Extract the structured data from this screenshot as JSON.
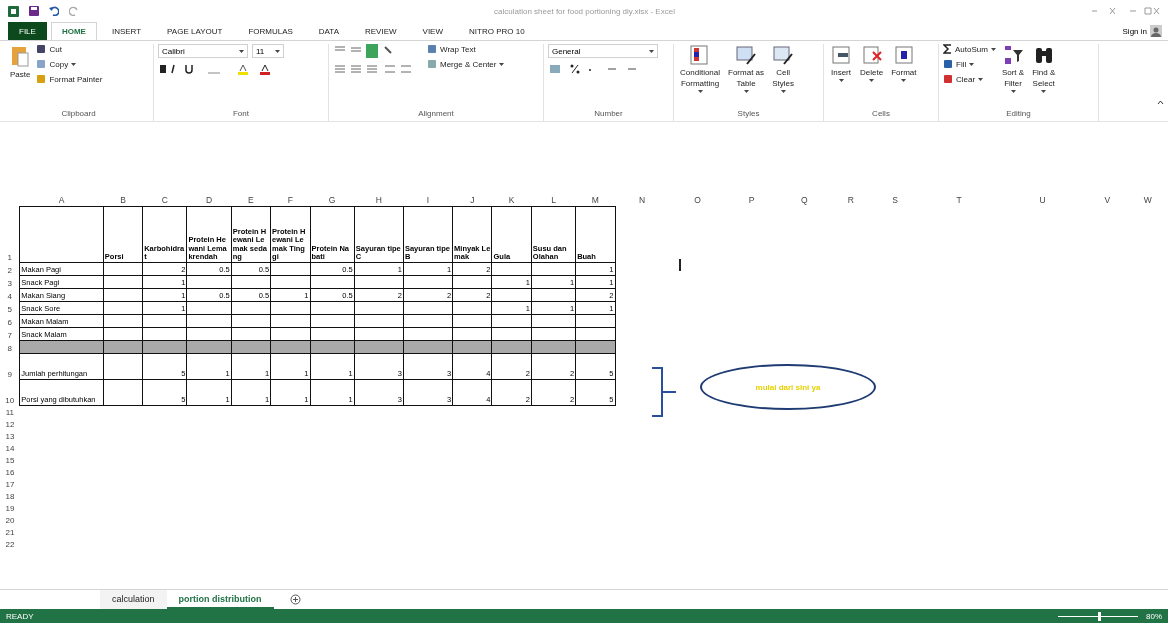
{
  "title_bar": {
    "title": "calculation sheet for food portioning diy.xlsx - Excel"
  },
  "ribbon_tabs": [
    {
      "label": "FILE",
      "kind": "file",
      "selected": false
    },
    {
      "label": "HOME",
      "kind": "tab",
      "selected": true
    },
    {
      "label": "INSERT",
      "kind": "tab",
      "selected": false
    },
    {
      "label": "PAGE LAYOUT",
      "kind": "tab",
      "selected": false
    },
    {
      "label": "FORMULAS",
      "kind": "tab",
      "selected": false
    },
    {
      "label": "DATA",
      "kind": "tab",
      "selected": false
    },
    {
      "label": "REVIEW",
      "kind": "tab",
      "selected": false
    },
    {
      "label": "VIEW",
      "kind": "tab",
      "selected": false
    },
    {
      "label": "NITRO PRO 10",
      "kind": "tab",
      "selected": false
    }
  ],
  "account": {
    "label": "Sign in"
  },
  "clipboard": {
    "paste": "Paste",
    "cut": "Cut",
    "copy": "Copy",
    "format_painter": "Format Painter",
    "group": "Clipboard"
  },
  "font": {
    "name": "Calibri",
    "size": "11",
    "group": "Font"
  },
  "alignment": {
    "wrap": "Wrap Text",
    "merge": "Merge & Center",
    "group": "Alignment"
  },
  "number": {
    "format": "General",
    "group": "Number"
  },
  "styles": {
    "group": "Styles",
    "buttons": [
      {
        "lines": [
          "Conditional",
          "Formatting"
        ],
        "kind": "conditional"
      },
      {
        "lines": [
          "Format as",
          "Table"
        ],
        "kind": "table"
      },
      {
        "lines": [
          "Cell",
          "Styles"
        ],
        "kind": "styles"
      }
    ]
  },
  "cells": {
    "group": "Cells",
    "buttons": [
      {
        "lines": [
          "Insert"
        ],
        "kind": "insert"
      },
      {
        "lines": [
          "Delete"
        ],
        "kind": "delete"
      },
      {
        "lines": [
          "Format"
        ],
        "kind": "format"
      }
    ]
  },
  "editing": {
    "group": "Editing",
    "autosum": "AutoSum",
    "fill": "Fill",
    "clear": "Clear",
    "sort": [
      "Sort &",
      "Filter"
    ],
    "find": [
      "Find &",
      "Select"
    ]
  },
  "sheet": {
    "columns": [
      "A",
      "B",
      "C",
      "D",
      "E",
      "F",
      "G",
      "H",
      "I",
      "J",
      "K",
      "L",
      "M",
      "N",
      "O",
      "P",
      "Q",
      "R",
      "S",
      "T",
      "U",
      "V",
      "W"
    ],
    "rows": [
      {
        "number": "1",
        "kind": "header",
        "cells": [
          null,
          "Porsi",
          "Karbohidrat",
          "Protein Hewani Lemakrendah",
          "Protein Hewani Lemak sedang",
          "Protein Hewani Lemak Tinggi",
          "Protein Nabati",
          "Sayuran tipe C",
          "Sayuran tipe B",
          "Minyak Lemak",
          "Gula",
          "Susu dan Olahan",
          "Buah"
        ]
      },
      {
        "number": "2",
        "kind": "data",
        "cells": [
          "Makan Pagi",
          null,
          "2",
          "0.5",
          "0.5",
          null,
          "0.5",
          "1",
          "1",
          "2",
          null,
          null,
          "1"
        ]
      },
      {
        "number": "3",
        "kind": "data",
        "cells": [
          "Snack Pagi",
          null,
          "1",
          null,
          null,
          null,
          null,
          null,
          null,
          null,
          "1",
          "1",
          "1"
        ]
      },
      {
        "number": "4",
        "kind": "data",
        "cells": [
          "Makan Siang",
          null,
          "1",
          "0.5",
          "0.5",
          "1",
          "0.5",
          "2",
          "2",
          "2",
          null,
          null,
          "2"
        ]
      },
      {
        "number": "5",
        "kind": "data",
        "cells": [
          "Snack Sore",
          null,
          "1",
          null,
          null,
          null,
          null,
          null,
          null,
          null,
          "1",
          "1",
          "1"
        ]
      },
      {
        "number": "6",
        "kind": "data",
        "cells": [
          "Makan Malam",
          null,
          null,
          null,
          null,
          null,
          null,
          null,
          null,
          null,
          null,
          null,
          null
        ]
      },
      {
        "number": "7",
        "kind": "data",
        "cells": [
          "Snack Malam",
          null,
          null,
          null,
          null,
          null,
          null,
          null,
          null,
          null,
          null,
          null,
          null
        ]
      },
      {
        "number": "8",
        "kind": "separator",
        "cells": [
          null,
          null,
          null,
          null,
          null,
          null,
          null,
          null,
          null,
          null,
          null,
          null,
          null
        ]
      },
      {
        "number": "9",
        "kind": "total",
        "cells": [
          "Jumlah perhitungan",
          null,
          "5",
          "1",
          "1",
          "1",
          "1",
          "3",
          "3",
          "4",
          "2",
          "2",
          "5"
        ]
      },
      {
        "number": "10",
        "kind": "total",
        "cells": [
          "Porsi yang dibutuhkan",
          null,
          "5",
          "1",
          "1",
          "1",
          "1",
          "3",
          "3",
          "4",
          "2",
          "2",
          "5"
        ]
      }
    ],
    "empty_rows": [
      "11",
      "12",
      "13",
      "14",
      "15",
      "16",
      "17",
      "18",
      "19",
      "20",
      "21",
      "22"
    ],
    "callout": {
      "text": "mulai dari sini ya"
    }
  },
  "sheet_tabs": [
    {
      "label": "calculation",
      "selected": false
    },
    {
      "label": "portion distribution",
      "selected": true
    }
  ],
  "status_bar": {
    "status": "READY",
    "zoom": "80%",
    "zoom_level": {
      "level": 0.5
    }
  }
}
